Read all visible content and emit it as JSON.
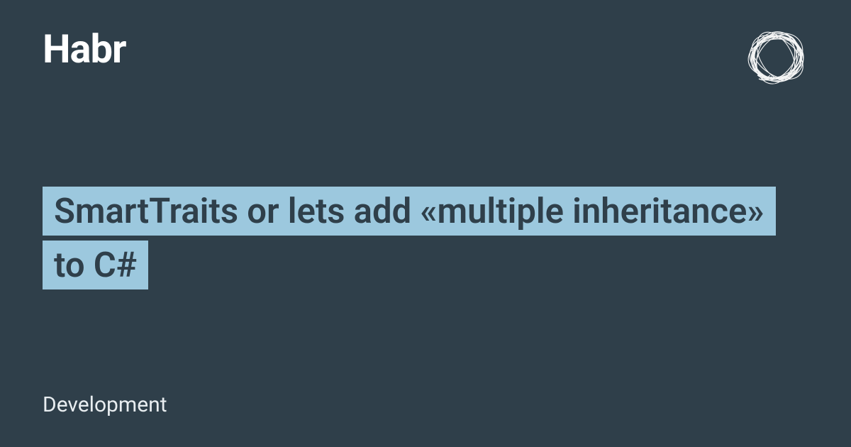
{
  "header": {
    "logo_text": "Habr"
  },
  "article": {
    "title": "SmartTraits or lets add «multiple inheritance» to C#",
    "category": "Development"
  },
  "colors": {
    "background": "#2f3f4a",
    "highlight": "#9cc8de",
    "text_light": "#ffffff"
  }
}
